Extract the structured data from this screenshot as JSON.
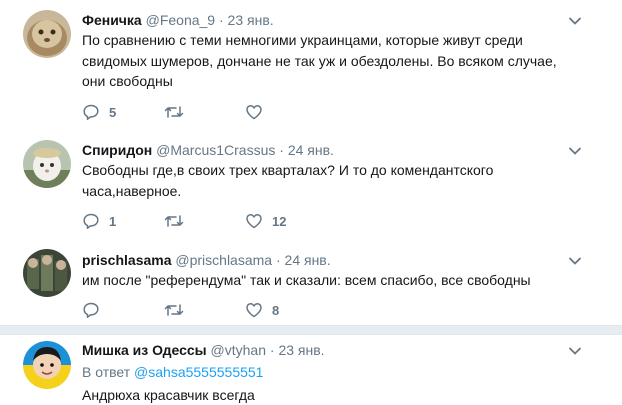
{
  "tweets": [
    {
      "name": "Феничка",
      "handle": "@Feona_9",
      "separator": "·",
      "date": "23 янв.",
      "text": "По сравнению с теми немногими украинцами, которые живут среди свидомых шумеров, дончане не так уж и обездолены. Во всяком случае, они свободны",
      "replies": "5",
      "retweets": "",
      "likes": ""
    },
    {
      "name": "Спиридон",
      "handle": "@Marcus1Crassus",
      "separator": "·",
      "date": "24 янв.",
      "text": "Свободны где,в своих трех кварталах? И то до комендантского часа,наверное.",
      "replies": "1",
      "retweets": "",
      "likes": "12"
    },
    {
      "name": "prischlasama",
      "handle": "@prischlasama",
      "separator": "·",
      "date": "24 янв.",
      "text": "им после \"референдума\" так и сказали: всем спасибо, все свободны",
      "replies": "",
      "retweets": "",
      "likes": "8"
    },
    {
      "name": "Мишка из Одессы",
      "handle": "@vtyhan",
      "separator": "·",
      "date": "23 янв.",
      "reply_prefix": "В ответ",
      "reply_handle": "@sahsa5555555551",
      "text": "Андрюха красавчик всегда"
    }
  ],
  "icons": [
    "reply-icon",
    "retweet-icon",
    "like-icon",
    "chevron-down-icon"
  ],
  "colors": {
    "accent": "#1da1f2",
    "muted": "#657786",
    "divider": "#e6ecf0"
  }
}
